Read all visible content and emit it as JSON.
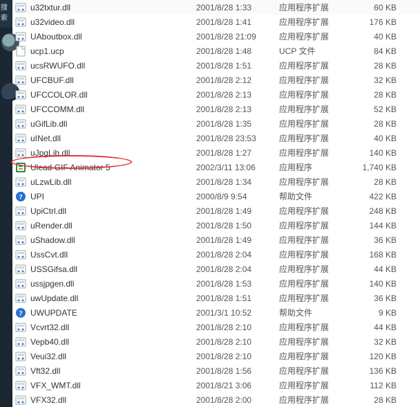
{
  "leftstrip_label": "搜索",
  "files": [
    {
      "name": "u32txtur.dll",
      "date": "2001/8/28 1:33",
      "type": "应用程序扩展",
      "size": "60 KB",
      "icon": "dll"
    },
    {
      "name": "u32video.dll",
      "date": "2001/8/28 1:41",
      "type": "应用程序扩展",
      "size": "176 KB",
      "icon": "dll"
    },
    {
      "name": "UAboutbox.dll",
      "date": "2001/8/28 21:09",
      "type": "应用程序扩展",
      "size": "40 KB",
      "icon": "dll"
    },
    {
      "name": "ucp1.ucp",
      "date": "2001/8/28 1:48",
      "type": "UCP 文件",
      "size": "84 KB",
      "icon": "file"
    },
    {
      "name": "ucsRWUFO.dll",
      "date": "2001/8/28 1:51",
      "type": "应用程序扩展",
      "size": "28 KB",
      "icon": "dll"
    },
    {
      "name": "UFCBUF.dll",
      "date": "2001/8/28 2:12",
      "type": "应用程序扩展",
      "size": "32 KB",
      "icon": "dll"
    },
    {
      "name": "UFCCOLOR.dll",
      "date": "2001/8/28 2:13",
      "type": "应用程序扩展",
      "size": "28 KB",
      "icon": "dll"
    },
    {
      "name": "UFCCOMM.dll",
      "date": "2001/8/28 2:13",
      "type": "应用程序扩展",
      "size": "52 KB",
      "icon": "dll"
    },
    {
      "name": "uGifLib.dll",
      "date": "2001/8/28 1:35",
      "type": "应用程序扩展",
      "size": "28 KB",
      "icon": "dll"
    },
    {
      "name": "uINet.dll",
      "date": "2001/8/28 23:53",
      "type": "应用程序扩展",
      "size": "40 KB",
      "icon": "dll"
    },
    {
      "name": "uJpgLib.dll",
      "date": "2001/8/28 1:27",
      "type": "应用程序扩展",
      "size": "140 KB",
      "icon": "dll"
    },
    {
      "name": "Ulead GIF Animator 5",
      "date": "2002/3/11 13:06",
      "type": "应用程序",
      "size": "1,740 KB",
      "icon": "exe"
    },
    {
      "name": "uLzwLib.dll",
      "date": "2001/8/28 1:34",
      "type": "应用程序扩展",
      "size": "28 KB",
      "icon": "dll"
    },
    {
      "name": "UPI",
      "date": "2000/8/9 9:54",
      "type": "帮助文件",
      "size": "422 KB",
      "icon": "help"
    },
    {
      "name": "UpiCtrl.dll",
      "date": "2001/8/28 1:49",
      "type": "应用程序扩展",
      "size": "248 KB",
      "icon": "dll"
    },
    {
      "name": "uRender.dll",
      "date": "2001/8/28 1:50",
      "type": "应用程序扩展",
      "size": "144 KB",
      "icon": "dll"
    },
    {
      "name": "uShadow.dll",
      "date": "2001/8/28 1:49",
      "type": "应用程序扩展",
      "size": "36 KB",
      "icon": "dll"
    },
    {
      "name": "UssCvt.dll",
      "date": "2001/8/28 2:04",
      "type": "应用程序扩展",
      "size": "168 KB",
      "icon": "dll"
    },
    {
      "name": "USSGifsa.dll",
      "date": "2001/8/28 2:04",
      "type": "应用程序扩展",
      "size": "44 KB",
      "icon": "dll"
    },
    {
      "name": "ussjpgen.dll",
      "date": "2001/8/28 1:53",
      "type": "应用程序扩展",
      "size": "140 KB",
      "icon": "dll"
    },
    {
      "name": "uwUpdate.dll",
      "date": "2001/8/28 1:51",
      "type": "应用程序扩展",
      "size": "36 KB",
      "icon": "dll"
    },
    {
      "name": "UWUPDATE",
      "date": "2001/3/1 10:52",
      "type": "帮助文件",
      "size": "9 KB",
      "icon": "help"
    },
    {
      "name": "Vcvrt32.dll",
      "date": "2001/8/28 2:10",
      "type": "应用程序扩展",
      "size": "44 KB",
      "icon": "dll"
    },
    {
      "name": "Vepb40.dll",
      "date": "2001/8/28 2:10",
      "type": "应用程序扩展",
      "size": "32 KB",
      "icon": "dll"
    },
    {
      "name": "Veui32.dll",
      "date": "2001/8/28 2:10",
      "type": "应用程序扩展",
      "size": "120 KB",
      "icon": "dll"
    },
    {
      "name": "Vft32.dll",
      "date": "2001/8/28 1:56",
      "type": "应用程序扩展",
      "size": "136 KB",
      "icon": "dll"
    },
    {
      "name": "VFX_WMT.dll",
      "date": "2001/8/21 3:06",
      "type": "应用程序扩展",
      "size": "112 KB",
      "icon": "dll"
    },
    {
      "name": "VFX32.dll",
      "date": "2001/8/28 2:00",
      "type": "应用程序扩展",
      "size": "28 KB",
      "icon": "dll"
    }
  ]
}
